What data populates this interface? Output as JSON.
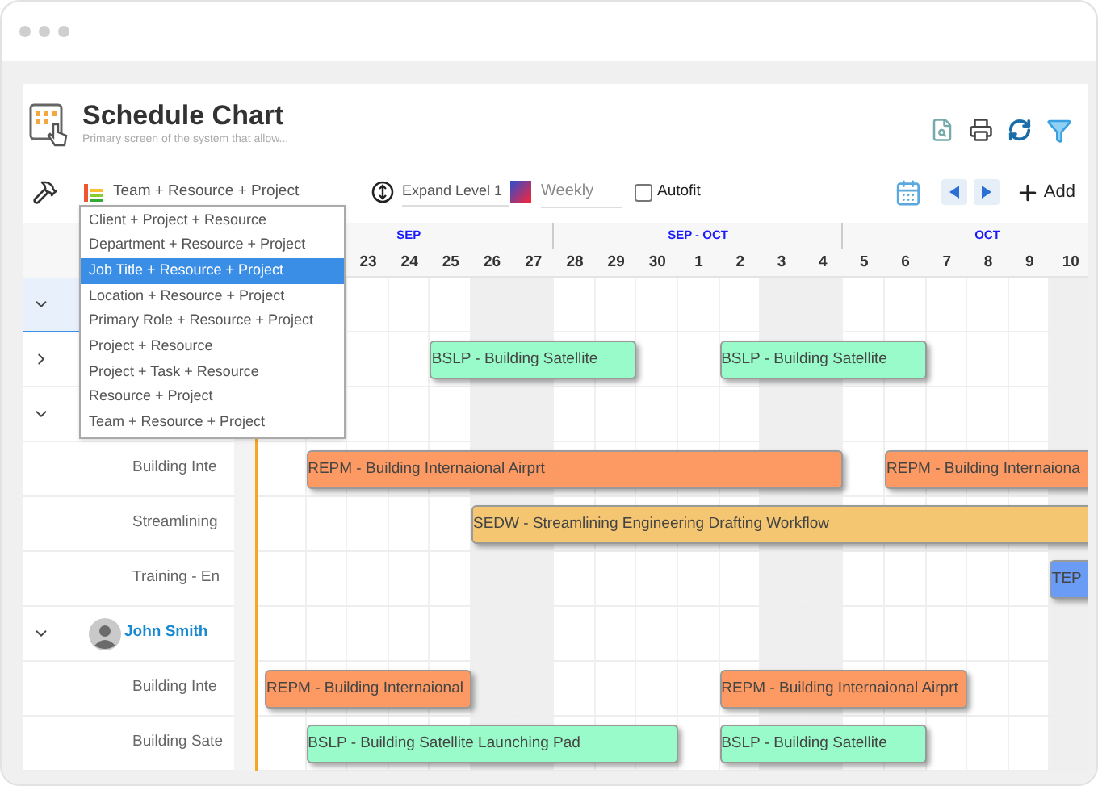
{
  "header": {
    "title": "Schedule Chart",
    "subtitle": "Primary screen of the system that allow..."
  },
  "toolbar": {
    "grouping": "Team + Resource + Project",
    "expand": "Expand Level 1",
    "view_placeholder": "Weekly",
    "autofit": {
      "label": "Autofit",
      "checked": false
    },
    "add": "Add"
  },
  "grouping_options": [
    {
      "label": "Client + Project + Resource",
      "selected": false
    },
    {
      "label": "Department + Resource + Project",
      "selected": false
    },
    {
      "label": "Job Title + Resource + Project",
      "selected": true
    },
    {
      "label": "Location + Resource + Project",
      "selected": false
    },
    {
      "label": "Primary Role + Resource + Project",
      "selected": false
    },
    {
      "label": "Project + Resource",
      "selected": false
    },
    {
      "label": "Project + Task + Resource",
      "selected": false
    },
    {
      "label": "Resource + Project",
      "selected": false
    },
    {
      "label": "Team + Resource + Project",
      "selected": false
    }
  ],
  "months": [
    {
      "label": "SEP"
    },
    {
      "label": "SEP - OCT"
    },
    {
      "label": "OCT"
    }
  ],
  "days": [
    {
      "label": "23",
      "weekend": false
    },
    {
      "label": "24",
      "weekend": false
    },
    {
      "label": "25",
      "weekend": false
    },
    {
      "label": "26",
      "weekend": true
    },
    {
      "label": "27",
      "weekend": true
    },
    {
      "label": "28",
      "weekend": false
    },
    {
      "label": "29",
      "weekend": false
    },
    {
      "label": "30",
      "weekend": false
    },
    {
      "label": "1",
      "weekend": false
    },
    {
      "label": "2",
      "weekend": false
    },
    {
      "label": "3",
      "weekend": true
    },
    {
      "label": "4",
      "weekend": true
    },
    {
      "label": "5",
      "weekend": false
    },
    {
      "label": "6",
      "weekend": false
    },
    {
      "label": "7",
      "weekend": false
    },
    {
      "label": "8",
      "weekend": false
    },
    {
      "label": "9",
      "weekend": false
    },
    {
      "label": "10",
      "weekend": true
    }
  ],
  "rows": [
    {
      "kind": "group",
      "expanded": true,
      "selected": true,
      "bars": []
    },
    {
      "kind": "resource",
      "expanded": false,
      "selected": false,
      "bars": [
        {
          "label": "BSLP - Building Satellite",
          "color": "#99fbc9"
        },
        {
          "label": "BSLP - Building Satellite",
          "color": "#99fbc9"
        }
      ]
    },
    {
      "kind": "resource",
      "expanded": true,
      "selected": false,
      "bars": [],
      "children": [
        {
          "kind": "task",
          "label": "Building Inte",
          "bars": [
            {
              "label": "REPM - Building Internaional Airprt",
              "color": "#fd9a63"
            },
            {
              "label": "REPM - Building Internaiona",
              "color": "#fd9a63"
            }
          ]
        },
        {
          "kind": "task",
          "label": "Streamlining",
          "bars": [
            {
              "label": "SEDW - Streamlining Engineering Drafting Workflow",
              "color": "#f4c672"
            }
          ]
        },
        {
          "kind": "task",
          "label": "Training - En",
          "bars": [
            {
              "label": "TEP",
              "color": "#6a9bf5"
            }
          ]
        }
      ]
    },
    {
      "kind": "resource",
      "name": "John Smith",
      "expanded": true,
      "selected": false,
      "bars": [],
      "children": [
        {
          "kind": "task",
          "label": "Building Inte",
          "bars": [
            {
              "label": "REPM - Building Internaional",
              "color": "#fd9a63"
            },
            {
              "label": "REPM - Building Internaional Airprt",
              "color": "#fd9a63"
            }
          ]
        },
        {
          "kind": "task",
          "label": "Building Sate",
          "bars": [
            {
              "label": "BSLP - Building Satellite Launching Pad",
              "color": "#99fbc9"
            },
            {
              "label": "BSLP - Building Satellite",
              "color": "#99fbc9"
            }
          ]
        }
      ]
    }
  ]
}
